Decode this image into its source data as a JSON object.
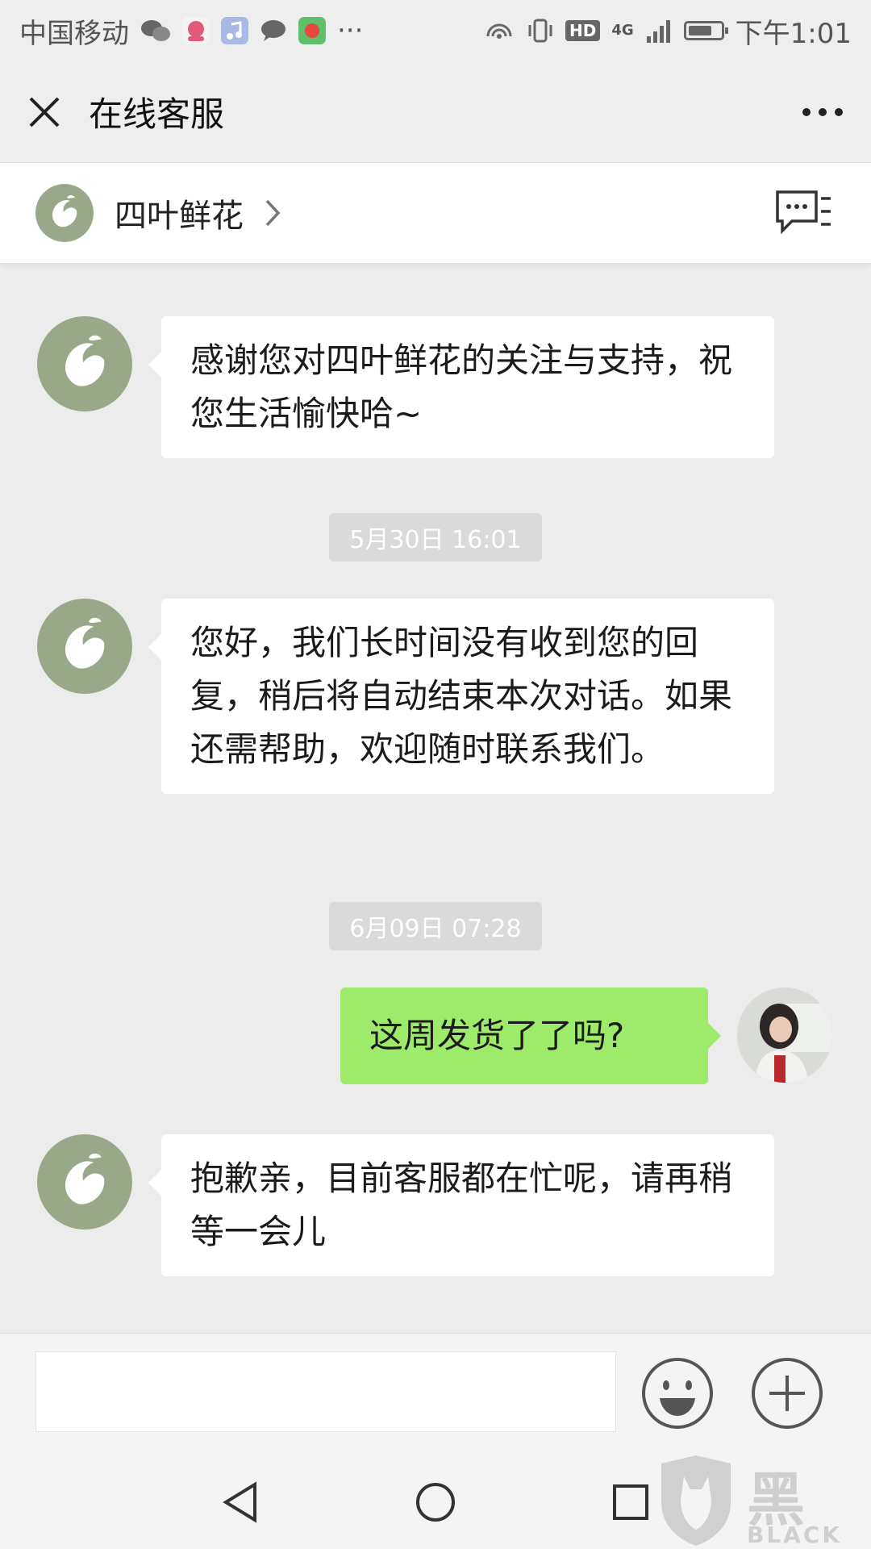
{
  "status_bar": {
    "carrier": "中国移动",
    "more": "···",
    "hd": "HD",
    "network": "4G",
    "time": "下午1:01"
  },
  "title_bar": {
    "title": "在线客服",
    "close_icon": "close-icon",
    "more_icon": "more-icon"
  },
  "merchant": {
    "name": "四叶鲜花",
    "logo_color": "#9aa88a"
  },
  "messages": [
    {
      "side": "left",
      "text": "感谢您对四叶鲜花的关注与支持，祝您生活愉快哈~"
    },
    {
      "side": "left",
      "text": "您好，我们长时间没有收到您的回复，稍后将自动结束本次对话。如果还需帮助，欢迎随时联系我们。"
    },
    {
      "side": "right",
      "text": "这周发货了了吗?"
    },
    {
      "side": "left",
      "text": "抱歉亲，目前客服都在忙呢，请再稍等一会儿"
    }
  ],
  "timestamps": [
    "5月30日 16:01",
    "6月09日 07:28"
  ],
  "input": {
    "value": "",
    "placeholder": ""
  },
  "colors": {
    "user_bubble": "#9eea6a",
    "agent_bubble": "#ffffff",
    "background": "#ececec"
  },
  "watermark": {
    "title": "黑猫",
    "subtitle": "BLACK CAT"
  }
}
